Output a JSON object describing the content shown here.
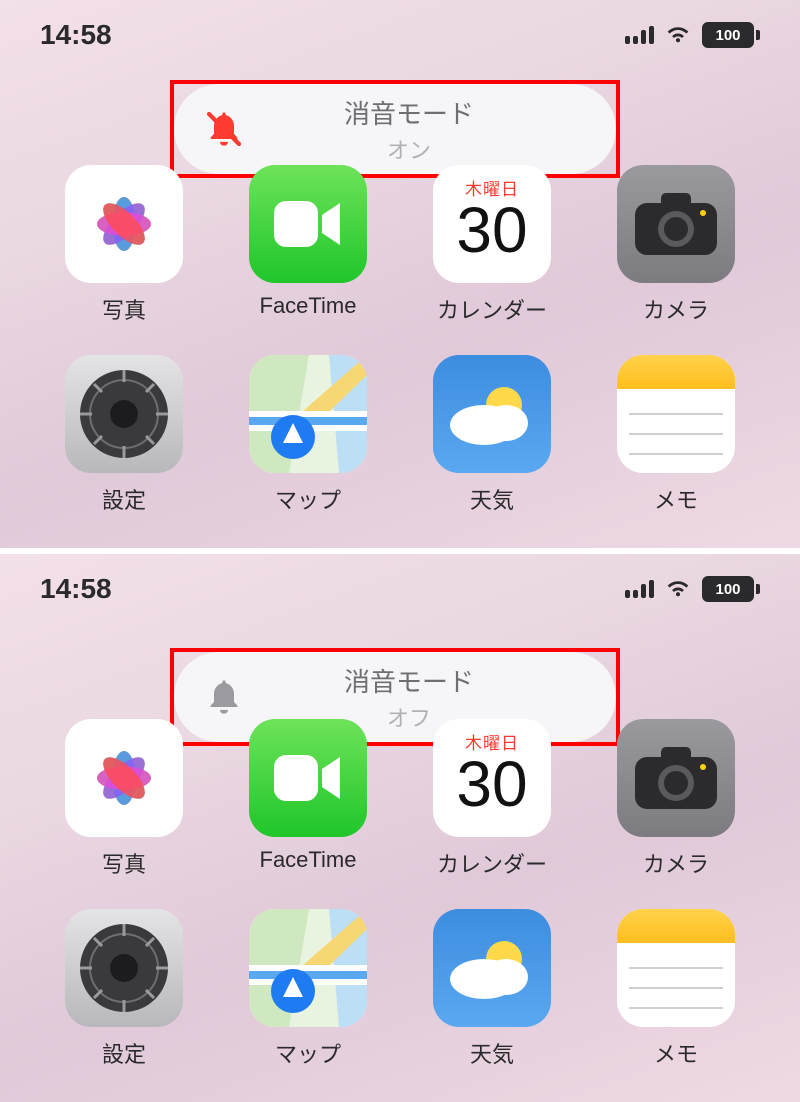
{
  "status": {
    "time": "14:58",
    "battery": "100"
  },
  "banner_on": {
    "title": "消音モード",
    "subtitle": "オン",
    "icon_color": "#ff3b30"
  },
  "banner_off": {
    "title": "消音モード",
    "subtitle": "オフ",
    "icon_color": "#9a9aa0"
  },
  "calendar": {
    "weekday": "木曜日",
    "date": "30"
  },
  "apps": {
    "photos": "写真",
    "facetime": "FaceTime",
    "calendar": "カレンダー",
    "camera": "カメラ",
    "settings": "設定",
    "maps": "マップ",
    "weather": "天気",
    "notes": "メモ"
  }
}
